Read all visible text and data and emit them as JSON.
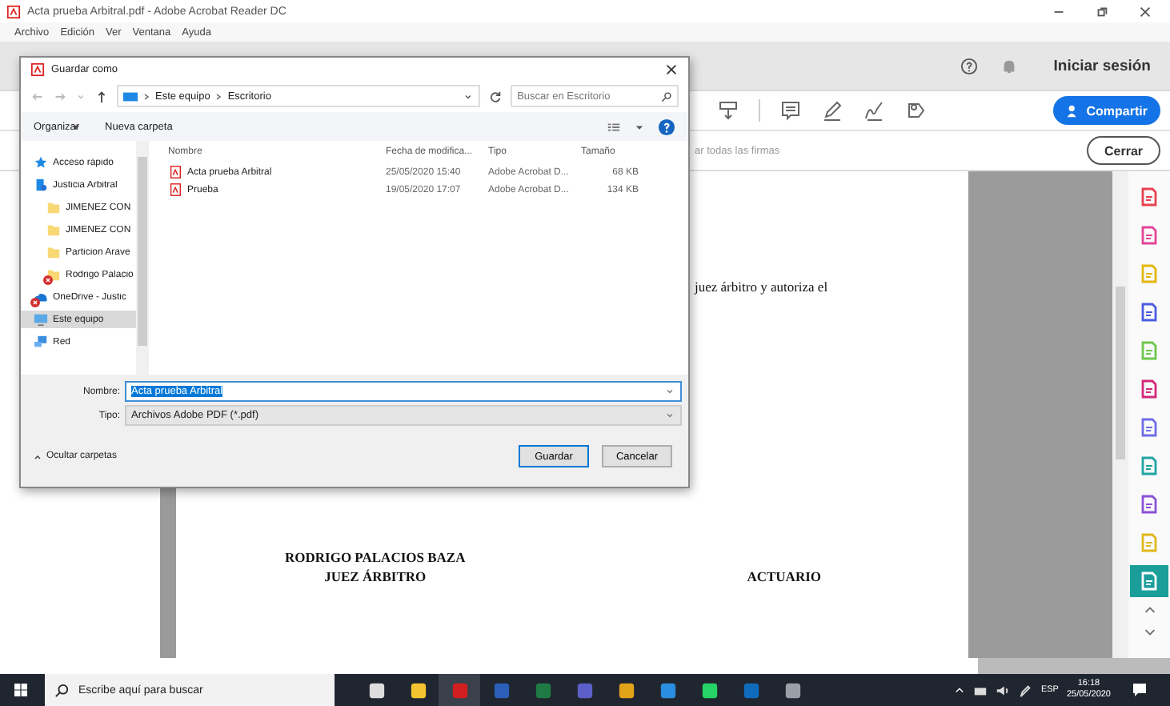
{
  "app_window": {
    "title": "Acta prueba Arbitral.pdf - Adobe Acrobat Reader DC"
  },
  "menu": [
    "Archivo",
    "Edición",
    "Ver",
    "Ventana",
    "Ayuda"
  ],
  "top_bar": {
    "sign_in": "Iniciar sesión"
  },
  "toolbar": {
    "share_button": "Compartir"
  },
  "signature_bar": {
    "hint": "ar todas las firmas",
    "close_button": "Cerrar"
  },
  "document": {
    "line": "juez árbitro y autoriza el",
    "signer_name": "RODRIGO PALACIOS BAZA",
    "signer_role": "JUEZ ÁRBITRO",
    "second_role": "ACTUARIO"
  },
  "tools_panel": [
    {
      "color": "#e8414f",
      "selected": false
    },
    {
      "color": "#e34597",
      "selected": false
    },
    {
      "color": "#e5b50f",
      "selected": false
    },
    {
      "color": "#4b5ce0",
      "selected": false
    },
    {
      "color": "#6cc84a",
      "selected": false
    },
    {
      "color": "#d4287a",
      "selected": false
    },
    {
      "color": "#6e6ce8",
      "selected": false
    },
    {
      "color": "#1fa3a0",
      "selected": false
    },
    {
      "color": "#8a52d6",
      "selected": false
    },
    {
      "color": "#e0b81a",
      "selected": false
    },
    {
      "color": "#ffffff",
      "selected": true
    }
  ],
  "dialog": {
    "title": "Guardar como",
    "path": [
      "Este equipo",
      "Escritorio"
    ],
    "search": {
      "placeholder": "Buscar en Escritorio"
    },
    "organize": "Organizar",
    "new_folder": "Nueva carpeta",
    "nav": [
      {
        "label": "Acceso rápido",
        "kind": "star",
        "error": false,
        "selected": false
      },
      {
        "label": "Justicia Arbitral",
        "kind": "person",
        "error": false,
        "selected": false
      },
      {
        "label": "JIMENEZ CON",
        "kind": "folder",
        "error": false,
        "selected": false
      },
      {
        "label": "JIMENEZ CON",
        "kind": "folder",
        "error": false,
        "selected": false
      },
      {
        "label": "Particion Arave",
        "kind": "folder",
        "error": false,
        "selected": false
      },
      {
        "label": "Rodrigo Palacio",
        "kind": "folder",
        "error": true,
        "selected": false
      },
      {
        "label": "OneDrive - Justic",
        "kind": "cloud",
        "error": true,
        "selected": false
      },
      {
        "label": "Este equipo",
        "kind": "pc",
        "error": false,
        "selected": true
      },
      {
        "label": "Red",
        "kind": "network",
        "error": false,
        "selected": false
      }
    ],
    "columns": [
      "Nombre",
      "Fecha de modifica...",
      "Tipo",
      "Tamaño"
    ],
    "files": [
      {
        "name": "Acta prueba Arbitral",
        "date": "25/05/2020 15:40",
        "type": "Adobe Acrobat D...",
        "size": "68 KB"
      },
      {
        "name": "Prueba",
        "date": "19/05/2020 17:07",
        "type": "Adobe Acrobat D...",
        "size": "134 KB"
      }
    ],
    "file_name": {
      "label": "Nombre:",
      "value": "Acta prueba Arbitral",
      "text_selected": true
    },
    "file_type": {
      "label": "Tipo:",
      "value": "Archivos Adobe PDF (*.pdf)"
    },
    "hide_folders": "Ocultar carpetas",
    "buttons": [
      {
        "label": "Guardar",
        "default": true
      },
      {
        "label": "Cancelar",
        "default": false
      }
    ]
  },
  "taskbar": {
    "search": {
      "placeholder": "Escribe aquí para buscar"
    },
    "apps": [
      {
        "color": "#dddddd",
        "selected": false
      },
      {
        "color": "#f4c430",
        "selected": false
      },
      {
        "color": "#d11f1f",
        "selected": true
      },
      {
        "color": "#2b5fb8",
        "selected": false
      },
      {
        "color": "#1f7a44",
        "selected": false
      },
      {
        "color": "#5b5fc7",
        "selected": false
      },
      {
        "color": "#e2a21a",
        "selected": false
      },
      {
        "color": "#2a8fe0",
        "selected": false
      },
      {
        "color": "#25d366",
        "selected": false
      },
      {
        "color": "#0f6cbd",
        "selected": false
      },
      {
        "color": "#9aa0a8",
        "selected": false
      }
    ],
    "language": "ESP",
    "time": "16:18",
    "date": "25/05/2020"
  }
}
